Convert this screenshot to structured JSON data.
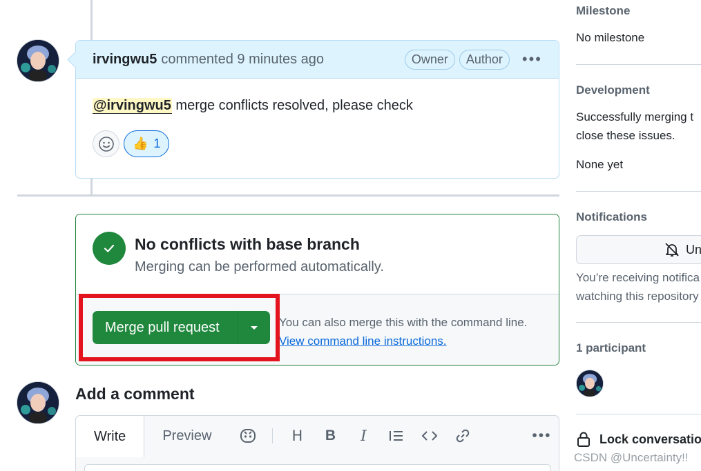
{
  "comment": {
    "author": "irvingwu5",
    "meta": "commented 9 minutes ago",
    "badges": [
      "Owner",
      "Author"
    ],
    "mention": "@irvingwu5",
    "body": "merge conflicts resolved, please check",
    "reaction_emoji": "👍",
    "reaction_count": "1"
  },
  "merge": {
    "title": "No conflicts with base branch",
    "subtitle": "Merging can be performed automatically.",
    "button_label": "Merge pull request",
    "hint": "You can also merge this with the command line.",
    "link": "View command line instructions."
  },
  "add_comment": {
    "title": "Add a comment",
    "tabs": [
      "Write",
      "Preview"
    ]
  },
  "sidebar": {
    "milestone_heading": "Milestone",
    "milestone_value": "No milestone",
    "development_heading": "Development",
    "development_text_1": "Successfully merging t",
    "development_text_2": "close these issues.",
    "development_value": "None yet",
    "notifications_heading": "Notifications",
    "notifications_button": "Un",
    "notifications_text_1": "You’re receiving notifica",
    "notifications_text_2": "watching this repository",
    "participants_heading": "1 participant",
    "lock_label": "Lock conversatio"
  },
  "watermark": "CSDN @Uncertainty!!",
  "colors": {
    "green": "#1f883d",
    "blue_link": "#0969da",
    "highlight_red": "#e3141e",
    "header_blue": "#ddf4ff"
  }
}
